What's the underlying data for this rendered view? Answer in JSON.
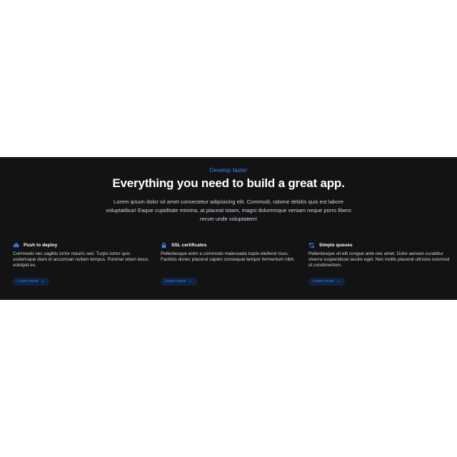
{
  "section": {
    "eyebrow": "Develop faster",
    "headline": "Everything you need to build a great app.",
    "intro": "Lorem ipsum dolor sit amet consectetur adipisicing elit. Commodi, ratione debitis quis est labore voluptatibus! Eaque cupiditate minima, at placeat totam, magni doloremque veniam neque porro libero rerum unde voluptatem!"
  },
  "features": [
    {
      "icon": "cloud-upload-icon",
      "title": "Push to deploy",
      "description": "Commodo nec sagittis tortor mauris sed. Turpis tortor quis scelerisque diam id accumsan nullam tempus. Pulvinar etiam lacus volutpat eu.",
      "link_label": "Learn more",
      "link_arrow": "→"
    },
    {
      "icon": "lock-icon",
      "title": "SSL certificates",
      "description": "Pellentesque enim a commodo malesuada turpis eleifend risus. Facilisis donec placerat sapien consequat tempor fermentum nibh.",
      "link_label": "Learn more",
      "link_arrow": "→"
    },
    {
      "icon": "refresh-icon",
      "title": "Simple queues",
      "description": "Pellentesque sit elit congue ante nec amet. Dolor aenean curabitur viverra suspendisse iaculis eget. Nec mollis placerat ultricies euismod ut condimentum.",
      "link_label": "Learn more",
      "link_arrow": "→"
    }
  ],
  "colors": {
    "background": "#131313",
    "accent": "#3b82f6",
    "button_bg": "#0f2440"
  }
}
